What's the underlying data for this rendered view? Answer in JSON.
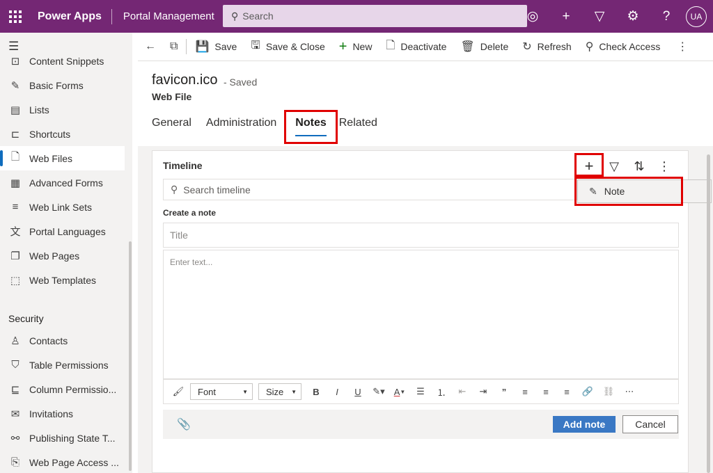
{
  "topbar": {
    "app_name": "Power Apps",
    "site_name": "Portal Management",
    "search_placeholder": "Search",
    "avatar_initials": "UA",
    "brand_color": "#742774"
  },
  "nav": {
    "items_top": [
      {
        "label": "Content Snippets",
        "icon": "snippet-icon"
      },
      {
        "label": "Basic Forms",
        "icon": "form-icon"
      },
      {
        "label": "Lists",
        "icon": "list-icon"
      },
      {
        "label": "Shortcuts",
        "icon": "shortcut-icon"
      },
      {
        "label": "Web Files",
        "icon": "web-file-icon",
        "active": true
      },
      {
        "label": "Advanced Forms",
        "icon": "advanced-form-icon"
      },
      {
        "label": "Web Link Sets",
        "icon": "link-set-icon"
      },
      {
        "label": "Portal Languages",
        "icon": "language-icon"
      },
      {
        "label": "Web Pages",
        "icon": "web-page-icon"
      },
      {
        "label": "Web Templates",
        "icon": "template-icon"
      }
    ],
    "section_security": "Security",
    "items_security": [
      {
        "label": "Contacts",
        "icon": "contact-icon"
      },
      {
        "label": "Table Permissions",
        "icon": "table-permission-icon"
      },
      {
        "label": "Column Permissio...",
        "icon": "column-permission-icon"
      },
      {
        "label": "Invitations",
        "icon": "invitation-icon"
      },
      {
        "label": "Publishing State T...",
        "icon": "publishing-icon"
      },
      {
        "label": "Web Page Access ...",
        "icon": "access-icon"
      }
    ]
  },
  "commands": {
    "save": "Save",
    "save_close": "Save & Close",
    "new": "New",
    "deactivate": "Deactivate",
    "delete": "Delete",
    "refresh": "Refresh",
    "check_access": "Check Access"
  },
  "record": {
    "title": "favicon.ico",
    "status": "- Saved",
    "entity": "Web File"
  },
  "tabs": {
    "general": "General",
    "administration": "Administration",
    "notes": "Notes",
    "related": "Related"
  },
  "timeline": {
    "title": "Timeline",
    "search_placeholder": "Search timeline",
    "create_note_label": "Create a note",
    "note_title_placeholder": "Title",
    "note_body_placeholder": "Enter text...",
    "font_select": "Font",
    "size_select": "Size",
    "add_note": "Add note",
    "cancel": "Cancel",
    "popup_note": "Note"
  }
}
